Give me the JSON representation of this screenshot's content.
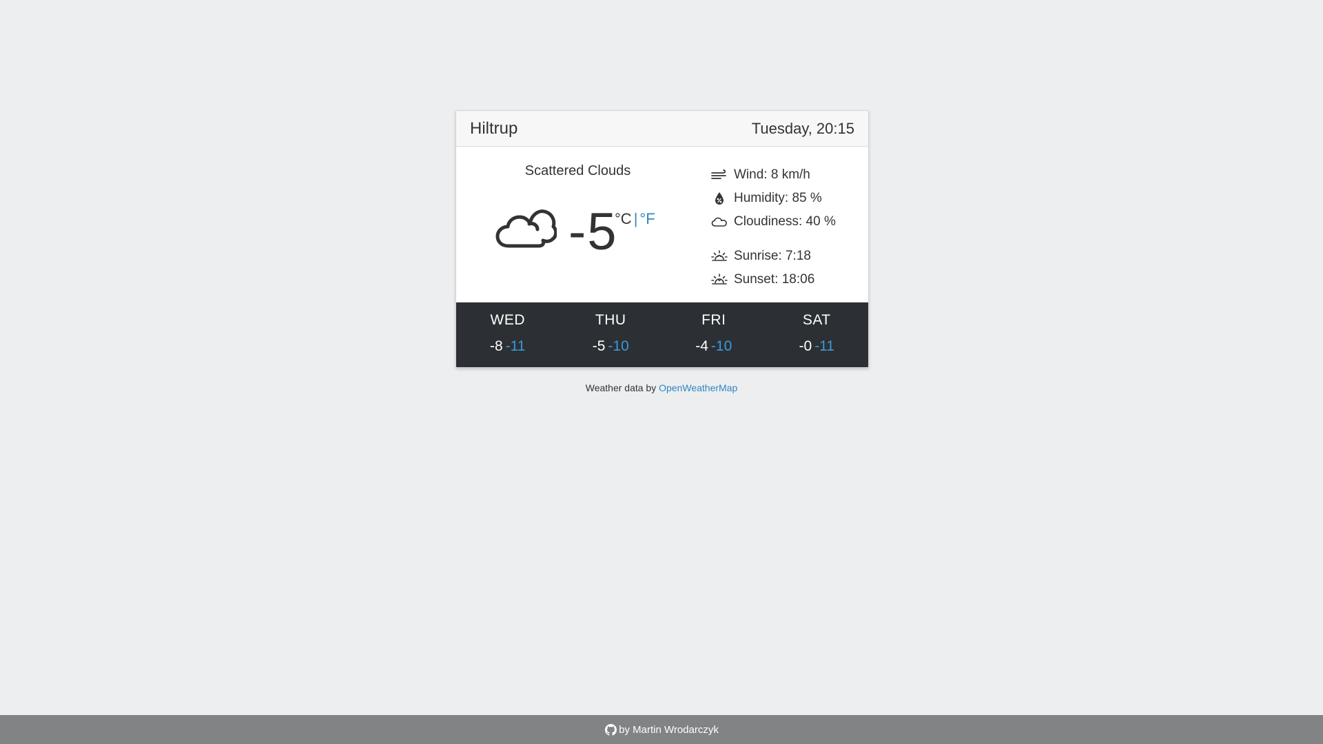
{
  "header": {
    "city": "Hiltrup",
    "datetime": "Tuesday, 20:15"
  },
  "current": {
    "condition": "Scattered Clouds",
    "icon": "cloud-icon",
    "temperature": "-5",
    "unit_celsius": "°C",
    "unit_separator": "|",
    "unit_fahrenheit": "°F"
  },
  "details": {
    "wind": "Wind: 8 km/h",
    "humidity": "Humidity: 85 %",
    "cloudiness": "Cloudiness: 40 %",
    "sunrise": "Sunrise: 7:18",
    "sunset": "Sunset: 18:06"
  },
  "forecast": [
    {
      "day": "WED",
      "high": "-8",
      "low": "-11"
    },
    {
      "day": "THU",
      "high": "-5",
      "low": "-10"
    },
    {
      "day": "FRI",
      "high": "-4",
      "low": "-10"
    },
    {
      "day": "SAT",
      "high": "-0",
      "low": "-11"
    }
  ],
  "credit": {
    "prefix": "Weather data by",
    "link_text": "OpenWeatherMap"
  },
  "footer": {
    "text": "by Martin Wrodarczyk"
  },
  "colors": {
    "accent": "#2e86c1",
    "forecast_bg": "#2c2f33",
    "footer_bg": "#818385",
    "page_bg": "#edeef0"
  }
}
